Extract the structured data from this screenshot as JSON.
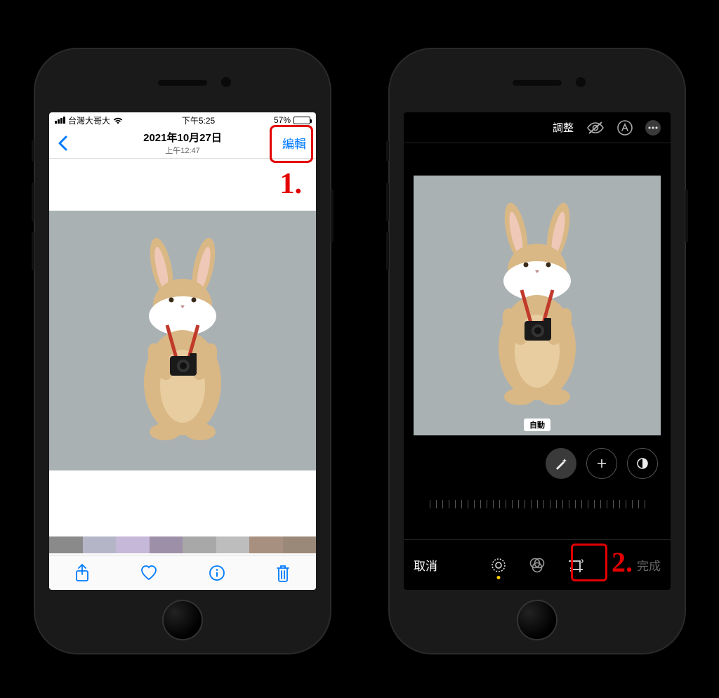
{
  "left": {
    "status": {
      "carrier": "台灣大哥大",
      "time": "下午5:25",
      "battery_pct": "57%",
      "battery_fill": 57
    },
    "nav": {
      "date": "2021年10月27日",
      "time": "上午12:47",
      "edit_label": "編輯"
    },
    "annotation": "1."
  },
  "right": {
    "top": {
      "adjust_label": "調整"
    },
    "auto_label": "自動",
    "bottom": {
      "cancel": "取消",
      "done": "完成"
    },
    "annotation": "2."
  },
  "thumb_colors": [
    "#8a8a8a",
    "#b5b5c8",
    "#c5b8d8",
    "#9e8fa8",
    "#a8a8a8",
    "#bdbdbd",
    "#a89080",
    "#9a8878"
  ]
}
